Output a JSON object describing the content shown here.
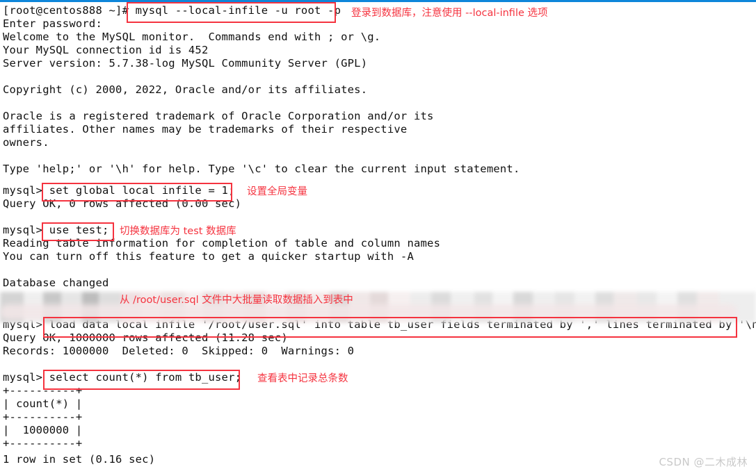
{
  "window": {
    "kind": "terminal-screenshot",
    "accent_blue": "#0e86da",
    "annotation_red": "#f5333f",
    "text_color": "#111111",
    "background": "#ffffff"
  },
  "terminal": {
    "lines": [
      {
        "id": "l01",
        "text": "[root@centos888 ~]# mysql --local-infile -u root -p"
      },
      {
        "id": "l02",
        "text": "Enter password:"
      },
      {
        "id": "l03",
        "text": "Welcome to the MySQL monitor.  Commands end with ; or \\g."
      },
      {
        "id": "l04",
        "text": "Your MySQL connection id is 452"
      },
      {
        "id": "l05",
        "text": "Server version: 5.7.38-log MySQL Community Server (GPL)"
      },
      {
        "id": "l06",
        "text": ""
      },
      {
        "id": "l07",
        "text": "Copyright (c) 2000, 2022, Oracle and/or its affiliates."
      },
      {
        "id": "l08",
        "text": ""
      },
      {
        "id": "l09",
        "text": "Oracle is a registered trademark of Oracle Corporation and/or its"
      },
      {
        "id": "l10",
        "text": "affiliates. Other names may be trademarks of their respective"
      },
      {
        "id": "l11",
        "text": "owners."
      },
      {
        "id": "l12",
        "text": ""
      },
      {
        "id": "l13",
        "text": "Type 'help;' or '\\h' for help. Type '\\c' to clear the current input statement."
      },
      {
        "id": "l14",
        "text": ""
      },
      {
        "id": "l15",
        "text": "mysql> set global local infile = 1;"
      },
      {
        "id": "l16",
        "text": "Query OK, 0 rows affected (0.00 sec)"
      },
      {
        "id": "l17",
        "text": ""
      },
      {
        "id": "l18",
        "text": "mysql> use test;"
      },
      {
        "id": "l19",
        "text": "Reading table information for completion of table and column names"
      },
      {
        "id": "l20",
        "text": "You can turn off this feature to get a quicker startup with -A"
      },
      {
        "id": "l21",
        "text": ""
      },
      {
        "id": "l22",
        "text": "Database changed"
      },
      {
        "id": "l23",
        "text": "mysql> load data local infile '/root/user.sql' into table tb_user fields terminated by ',' lines terminated by '\\n';"
      },
      {
        "id": "l24",
        "text": "Query OK, 1000000 rows affected (11.28 sec)"
      },
      {
        "id": "l25",
        "text": "Records: 1000000  Deleted: 0  Skipped: 0  Warnings: 0"
      },
      {
        "id": "l26",
        "text": ""
      },
      {
        "id": "l27",
        "text": "mysql> select count(*) from tb_user;"
      },
      {
        "id": "l28",
        "text": "+----------+"
      },
      {
        "id": "l29",
        "text": "| count(*) |"
      },
      {
        "id": "l30",
        "text": "+----------+"
      },
      {
        "id": "l31",
        "text": "|  1000000 |"
      },
      {
        "id": "l32",
        "text": "+----------+"
      },
      {
        "id": "l33",
        "text": "1 row in set (0.16 sec)"
      }
    ]
  },
  "annotations": {
    "login_note": "登录到数据库，注意使用 --local-infile 选项",
    "set_global_note": "设置全局变量",
    "use_db_note": "切换数据库为 test 数据库",
    "load_data_note": "从 /root/user.sql 文件中大批量读取数据插入到表中",
    "select_count_note": "查看表中记录总条数"
  },
  "watermark": {
    "text": "CSDN @二木成林"
  }
}
